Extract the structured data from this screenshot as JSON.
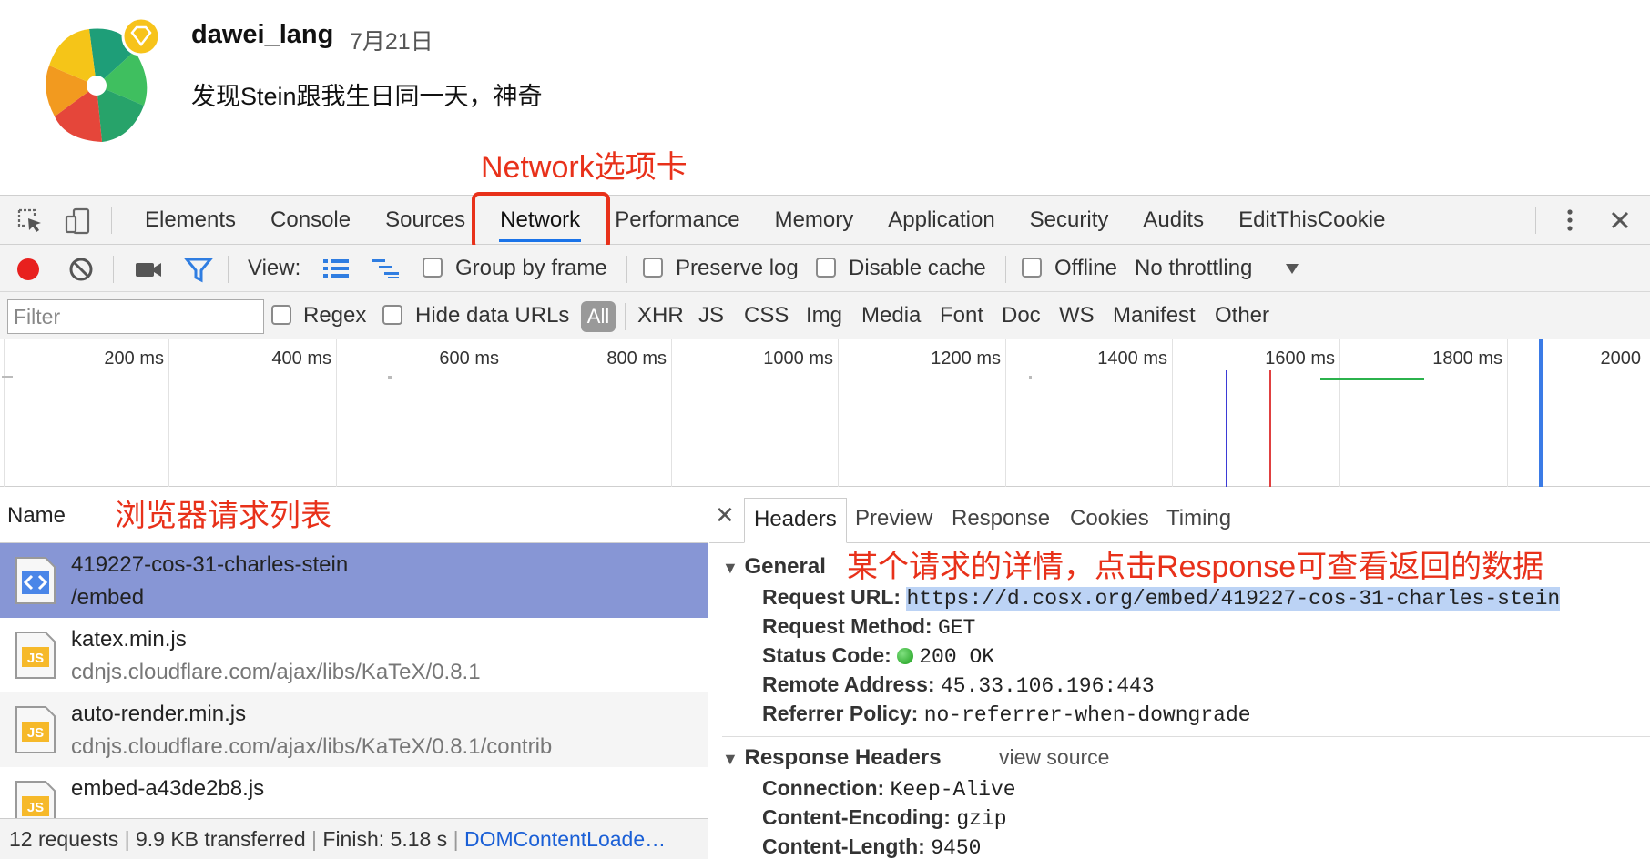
{
  "post": {
    "username": "dawei_lang",
    "date": "7月21日",
    "text": "发现Stein跟我生日同一天，神奇"
  },
  "annotations": {
    "network_tab": "Network选项卡",
    "request_list": "浏览器请求列表",
    "request_detail": "某个请求的详情，点击Response可查看返回的数据"
  },
  "devtools": {
    "tabs": [
      "Elements",
      "Console",
      "Sources",
      "Network",
      "Performance",
      "Memory",
      "Application",
      "Security",
      "Audits",
      "EditThisCookie"
    ],
    "active_tab": "Network",
    "toolbar": {
      "view_label": "View:",
      "group_by_frame": "Group by frame",
      "preserve_log": "Preserve log",
      "disable_cache": "Disable cache",
      "offline": "Offline",
      "throttling": "No throttling"
    },
    "filterbar": {
      "filter_placeholder": "Filter",
      "regex": "Regex",
      "hide_data_urls": "Hide data URLs",
      "all": "All",
      "types": [
        "XHR",
        "JS",
        "CSS",
        "Img",
        "Media",
        "Font",
        "Doc",
        "WS",
        "Manifest",
        "Other"
      ]
    },
    "timeline_ticks": [
      "200 ms",
      "400 ms",
      "600 ms",
      "800 ms",
      "1000 ms",
      "1200 ms",
      "1400 ms",
      "1600 ms",
      "1800 ms",
      "2000"
    ],
    "list": {
      "header": "Name",
      "rows": [
        {
          "name": "419227-cos-31-charles-stein",
          "sub": "/embed",
          "type": "doc"
        },
        {
          "name": "katex.min.js",
          "sub": "cdnjs.cloudflare.com/ajax/libs/KaTeX/0.8.1",
          "type": "js"
        },
        {
          "name": "auto-render.min.js",
          "sub": "cdnjs.cloudflare.com/ajax/libs/KaTeX/0.8.1/contrib",
          "type": "js"
        },
        {
          "name": "embed-a43de2b8.js",
          "sub": "",
          "type": "js"
        }
      ],
      "status": {
        "requests": "12 requests",
        "transferred": "9.9 KB transferred",
        "finish": "Finish: 5.18 s",
        "dom": "DOMContentLoade…"
      }
    },
    "detail": {
      "tabs": [
        "Headers",
        "Preview",
        "Response",
        "Cookies",
        "Timing"
      ],
      "active_tab": "Headers",
      "general_title": "General",
      "general": {
        "request_url_k": "Request URL:",
        "request_url_v": "https://d.cosx.org/embed/419227-cos-31-charles-stein",
        "request_method_k": "Request Method:",
        "request_method_v": "GET",
        "status_code_k": "Status Code:",
        "status_code_v": "200 OK",
        "remote_address_k": "Remote Address:",
        "remote_address_v": "45.33.106.196:443",
        "referrer_policy_k": "Referrer Policy:",
        "referrer_policy_v": "no-referrer-when-downgrade"
      },
      "response_headers_title": "Response Headers",
      "view_source": "view source",
      "response_headers": {
        "connection_k": "Connection:",
        "connection_v": "Keep-Alive",
        "content_encoding_k": "Content-Encoding:",
        "content_encoding_v": "gzip",
        "content_length_k": "Content-Length:",
        "content_length_v": "9450"
      }
    }
  },
  "colors": {
    "accent_blue": "#1a73e8",
    "annotation_red": "#e8311a",
    "selected_row": "#8796d5",
    "record_red": "#e8201e",
    "filter_blue": "#2f7de1"
  },
  "icons": [
    "inspect-icon",
    "device-toolbar-icon",
    "more-vertical-icon",
    "close-icon",
    "record-icon",
    "clear-icon",
    "camera-icon",
    "filter-icon",
    "list-view-icon",
    "waterfall-view-icon",
    "dropdown-arrow-icon",
    "document-file-icon",
    "js-file-icon",
    "status-ok-dot-icon",
    "collapse-triangle-icon"
  ]
}
